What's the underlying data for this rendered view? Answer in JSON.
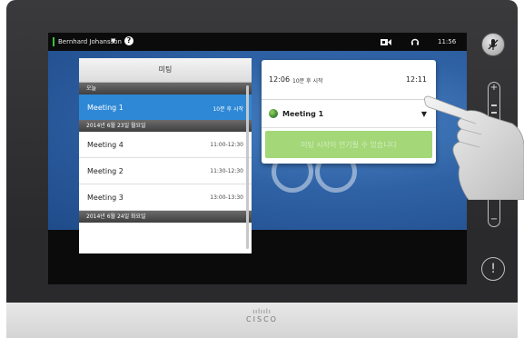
{
  "status_bar": {
    "user_name": "Bernhard Johansson",
    "user_caret": "▼",
    "help_glyph": "?",
    "camera_icon": "camera-icon",
    "headset_icon": "headset-icon",
    "time": "11:56"
  },
  "meetings_panel": {
    "title": "미팅",
    "sections": [
      {
        "date": "오늘",
        "items": [
          {
            "name": "Meeting 1",
            "time": "10분 후 시작",
            "selected": true
          }
        ]
      },
      {
        "date": "2014년 6월 23일 월요일",
        "items": [
          {
            "name": "Meeting 4",
            "time": "11:00-12:30"
          },
          {
            "name": "Meeting 2",
            "time": "11:30-12:30"
          },
          {
            "name": "Meeting 3",
            "time": "13:00-13:30"
          }
        ]
      },
      {
        "date": "2014년 6월 24일 화요일",
        "items": []
      }
    ]
  },
  "reminder_popup": {
    "start_time": "12:06",
    "start_note": "10분 후 시작",
    "end_time": "12:11",
    "selected_meeting": "Meeting 1",
    "dropdown_arrow": "▼",
    "confirm_label": "미팅 시작이 연기될 수 있습니다"
  },
  "side_controls": {
    "mute_icon": "mic-mute-icon",
    "volume_plus": "+",
    "volume_minus": "−",
    "alert_glyph": "!"
  },
  "brand": {
    "logo_bars": "ıılıılı",
    "logo_text": "CISCO"
  },
  "colors": {
    "selection_blue": "#2e88d6",
    "confirm_green": "#a3d777",
    "status_green": "#37c43a"
  }
}
